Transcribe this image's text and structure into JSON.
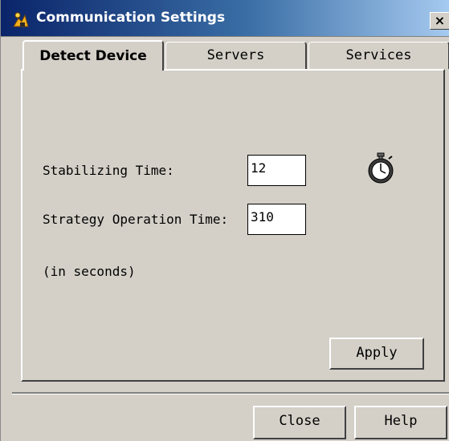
{
  "window": {
    "title": "Communication Settings",
    "close_label": "×"
  },
  "tabs": [
    {
      "label": "Detect Device",
      "active": true
    },
    {
      "label": "Servers",
      "active": false
    },
    {
      "label": "Services",
      "active": false
    }
  ],
  "form": {
    "stabilizing_label": "Stabilizing Time:",
    "stabilizing_value": "12",
    "strategy_label": "Strategy Operation Time:",
    "strategy_value": "310",
    "units_note": "(in seconds)"
  },
  "buttons": {
    "apply": "Apply",
    "close": "Close",
    "help": "Help"
  },
  "icons": {
    "title": "app-icon",
    "timer": "stopwatch-icon"
  },
  "colors": {
    "dialog_bg": "#d4d0c8",
    "titlebar_start": "#0a246a",
    "titlebar_end": "#a6caf0"
  }
}
